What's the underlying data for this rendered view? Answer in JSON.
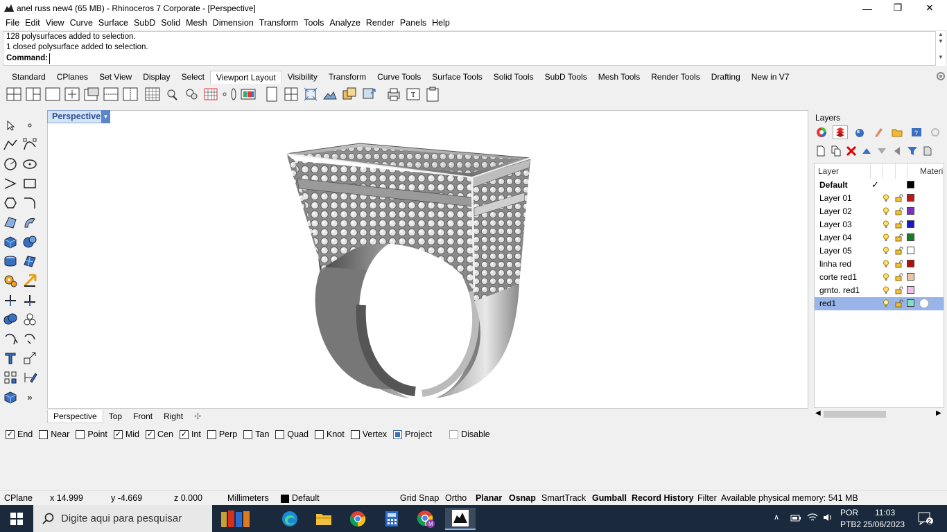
{
  "window": {
    "title": "anel russ new4 (65 MB) - Rhinoceros 7 Corporate - [Perspective]",
    "minimize_glyph": "—",
    "maximize_glyph": "❐",
    "close_glyph": "✕"
  },
  "menu": [
    "File",
    "Edit",
    "View",
    "Curve",
    "Surface",
    "SubD",
    "Solid",
    "Mesh",
    "Dimension",
    "Transform",
    "Tools",
    "Analyze",
    "Render",
    "Panels",
    "Help"
  ],
  "command": {
    "history": [
      "128 polysurfaces added to selection.",
      "1 closed polysurface added to selection."
    ],
    "prompt": "Command:",
    "value": ""
  },
  "toolbar_tabs": [
    "Standard",
    "CPlanes",
    "Set View",
    "Display",
    "Select",
    "Viewport Layout",
    "Visibility",
    "Transform",
    "Curve Tools",
    "Surface Tools",
    "Solid Tools",
    "SubD Tools",
    "Mesh Tools",
    "Render Tools",
    "Drafting",
    "New in V7"
  ],
  "active_toolbar_tab": "Viewport Layout",
  "viewport": {
    "label": "Perspective",
    "tabs": [
      "Perspective",
      "Top",
      "Front",
      "Right"
    ],
    "add_tab_glyph": "✣"
  },
  "layers": {
    "panel_title": "Layers",
    "headers": {
      "name": "Layer",
      "material": "Materi"
    },
    "rows": [
      {
        "name": "Default",
        "color": "#000000",
        "current": true
      },
      {
        "name": "Layer 01",
        "color": "#c01818"
      },
      {
        "name": "Layer 02",
        "color": "#8030c0"
      },
      {
        "name": "Layer 03",
        "color": "#1818c8"
      },
      {
        "name": "Layer 04",
        "color": "#1a7a28"
      },
      {
        "name": "Layer 05",
        "color": "#ffffff"
      },
      {
        "name": "linha red",
        "color": "#b01010"
      },
      {
        "name": "corte red1",
        "color": "#e8c8a0"
      },
      {
        "name": "grnto. red1",
        "color": "#f0c0f0"
      },
      {
        "name": "red1",
        "color": "#80e0c8",
        "selected": true
      }
    ]
  },
  "osnaps": [
    {
      "label": "End",
      "checked": true
    },
    {
      "label": "Near",
      "checked": false
    },
    {
      "label": "Point",
      "checked": false
    },
    {
      "label": "Mid",
      "checked": true
    },
    {
      "label": "Cen",
      "checked": true
    },
    {
      "label": "Int",
      "checked": true
    },
    {
      "label": "Perp",
      "checked": false
    },
    {
      "label": "Tan",
      "checked": false
    },
    {
      "label": "Quad",
      "checked": false
    },
    {
      "label": "Knot",
      "checked": false
    },
    {
      "label": "Vertex",
      "checked": false
    },
    {
      "label": "Project",
      "checked": "partial"
    },
    {
      "label": "Disable",
      "checked": false,
      "disabled": true
    }
  ],
  "status": {
    "cplane": "CPlane",
    "x": "x 14.999",
    "y": "y -4.669",
    "z": "z 0.000",
    "units": "Millimeters",
    "layer": "Default",
    "grid_snap": "Grid Snap",
    "ortho": "Ortho",
    "planar": "Planar",
    "osnap": "Osnap",
    "smarttrack": "SmartTrack",
    "gumball": "Gumball",
    "record_history": "Record History",
    "filter": "Filter",
    "memory": "Available physical memory: 541 MB"
  },
  "taskbar": {
    "search_placeholder": "Digite aqui para pesquisar",
    "lang": "POR",
    "layout": "PTB2",
    "time": "11:03",
    "date": "25/06/2023",
    "notifications": "2"
  }
}
